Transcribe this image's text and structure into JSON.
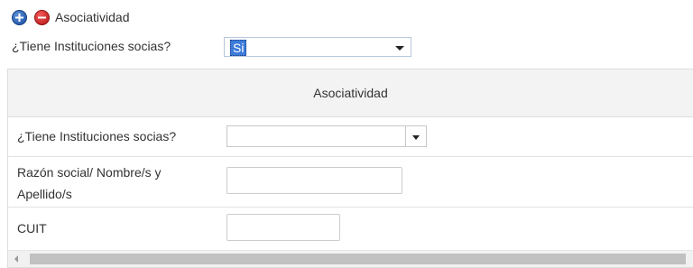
{
  "section": {
    "title": "Asociatividad",
    "add_icon": "plus-circle-icon",
    "remove_icon": "minus-circle-icon"
  },
  "top_question": {
    "label": "¿Tiene Instituciones socias?",
    "selected_value": "Si"
  },
  "panel": {
    "header": "Asociatividad",
    "fields": [
      {
        "label": "¿Tiene Instituciones socias?",
        "value": ""
      },
      {
        "label": "Razón social/ Nombre/s y Apellido/s",
        "value": ""
      },
      {
        "label": "CUIT",
        "value": ""
      }
    ]
  },
  "colors": {
    "accent_blue": "#3d7bd9",
    "add_button": "#1a4fa3",
    "remove_button": "#b71414",
    "panel_header_bg": "#f3f3f3"
  }
}
